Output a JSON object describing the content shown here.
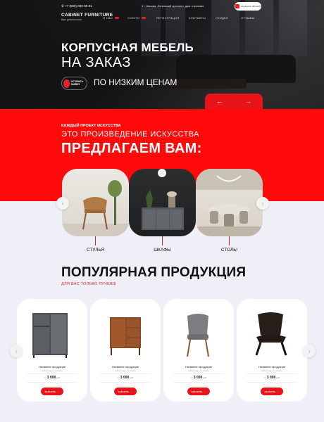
{
  "header": {
    "phone": "+7 (000) 000-00-01",
    "logo_title": "CABINET FURNITURE",
    "logo_subtitle": "Ваш девиз/слоган",
    "address": "г. Москва, Ленинский проспект, дом, строение",
    "top_button": "ЗАКАЗАТЬ ЗВОНОК",
    "nav": [
      "О НАС",
      "УСЛУГИ",
      "РЕГИСТРАЦИЯ",
      "КОНТАКТЫ",
      "СКИДКИ",
      "ОТЗЫВЫ"
    ]
  },
  "hero": {
    "title_line1": "КОРПУСНАЯ МЕБЕЛЬ",
    "title_line2": "НА ЗАКАЗ",
    "cta_label": "ОСТАВИТЬ ЗАЯВКУ",
    "tagline": "ПО НИЗКИМ ЦЕНАМ",
    "prev_arrow": "←",
    "next_arrow": "→"
  },
  "offer": {
    "kicker": "КАЖДЫЙ ПРОЕКТ ИСКУССТВА",
    "subtitle": "ЭТО ПРОИЗВЕДЕНИЕ ИСКУССТВА",
    "title": "ПРЕДЛАГАЕМ ВАМ:",
    "categories": [
      {
        "label": "СТУЛЬЯ",
        "icon": "chair-photo"
      },
      {
        "label": "ШКАФЫ",
        "icon": "cabinet-photo"
      },
      {
        "label": "СТОЛЫ",
        "icon": "dining-table-photo"
      }
    ],
    "prev": "‹",
    "next": "›"
  },
  "popular": {
    "title": "ПОПУЛЯРНАЯ ПРОДУКЦИЯ",
    "subtitle": "ДЛЯ ВАС ТОЛЬКО ЛУЧШЕЕ",
    "products": [
      {
        "name": "Название продукции",
        "desc": "небольшое описание",
        "price_prefix": "от",
        "price": "3 000",
        "currency": "руб",
        "button": "ЗАКАЗАТЬ"
      },
      {
        "name": "Название продукции",
        "desc": "небольшое описание",
        "price_prefix": "от",
        "price": "3 000",
        "currency": "руб",
        "button": "ЗАКАЗАТЬ"
      },
      {
        "name": "Название продукции",
        "desc": "небольшое описание",
        "price_prefix": "от",
        "price": "3 000",
        "currency": "руб",
        "button": "ЗАКАЗАТЬ"
      },
      {
        "name": "Название продукции",
        "desc": "небольшое описание",
        "price_prefix": "от",
        "price": "3 000",
        "currency": "руб",
        "button": "ЗАКАЗАТЬ"
      }
    ],
    "prev": "‹",
    "next": "›"
  },
  "colors": {
    "accent": "#e8141b",
    "red_band": "#ff0a0a",
    "page_bg": "#efeff7"
  }
}
